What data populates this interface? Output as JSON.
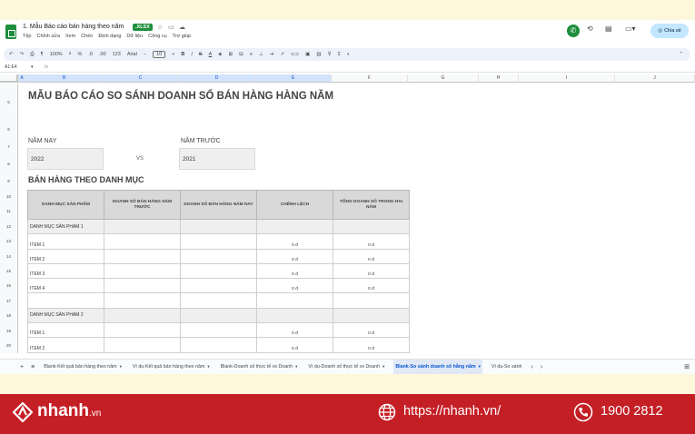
{
  "doc": {
    "title": "1. Mẫu Báo cáo bán hàng theo năm",
    "badge": ".XLSX",
    "menu": [
      "Tệp",
      "Chỉnh sửa",
      "Xem",
      "Chèn",
      "Định dạng",
      "Dữ liệu",
      "Công cụ",
      "Trợ giúp"
    ],
    "share_label": "Chia sẻ"
  },
  "toolbar": {
    "zoom": "100%",
    "currency": "₫",
    "percent": "%",
    "decimal_less": ".0",
    "decimal_more": ".00",
    "number_format": "123",
    "font": "Arial",
    "font_size": "10",
    "bold": "B",
    "italic": "I",
    "strike": "S",
    "text_color": "A"
  },
  "formula": {
    "cell_ref": "A1:E4",
    "fx": "fx"
  },
  "columns": [
    "A",
    "B",
    "C",
    "D",
    "E",
    "F",
    "G",
    "H",
    "I",
    "J"
  ],
  "rows": [
    "5",
    "6",
    "7",
    "8",
    "9",
    "10",
    "11",
    "12",
    "13",
    "14",
    "15",
    "16",
    "17",
    "18",
    "19",
    "20"
  ],
  "report": {
    "title": "MẪU BÁO CÁO SO SÁNH DOANH SỐ BÁN HÀNG HÀNG NĂM",
    "this_year_label": "NĂM NAY",
    "this_year_value": "2022",
    "vs": "VS",
    "last_year_label": "NĂM TRƯỚC",
    "last_year_value": "2021",
    "section_title": "BÁN HÀNG THEO DANH MỤC",
    "headers": [
      "DANH MỤC SẢN PHẨM",
      "DOANH SỐ BÁN HÀNG NĂM TRƯỚC",
      "DOANH SỐ BÁN HÀNG NĂM NAY",
      "CHÊNH LỆCH",
      "TỔNG DOANH SỐ TRONG HAI NĂM"
    ],
    "group1": "DANH MỤC SẢN PHẨM 1",
    "group2": "DANH MỤC SẢN PHẨM 2",
    "items": [
      "ITEM 1",
      "ITEM 2",
      "ITEM 3",
      "ITEM 4"
    ],
    "zero": "0 đ"
  },
  "sheet_tabs": [
    "Blank-Kết quả bán hàng theo năm",
    "Ví dụ-Kết quả bán hàng theo năm",
    "Blank-Doanh số thực tế vs Doanh",
    "Ví dụ-Doanh số thực tế vs Doanh",
    "Blank-So sánh doanh số hằng năm",
    "Ví dụ-So sánh"
  ],
  "banner": {
    "brand": "nhanh",
    "brand_suffix": ".vn",
    "url": "https://nhanh.vn/",
    "phone": "1900 2812"
  },
  "colors": {
    "sheets_green": "#1e8e3e",
    "banner_red": "#c51f26",
    "header_gray": "#d9d9d9",
    "active_tab": "#0b57d0"
  }
}
